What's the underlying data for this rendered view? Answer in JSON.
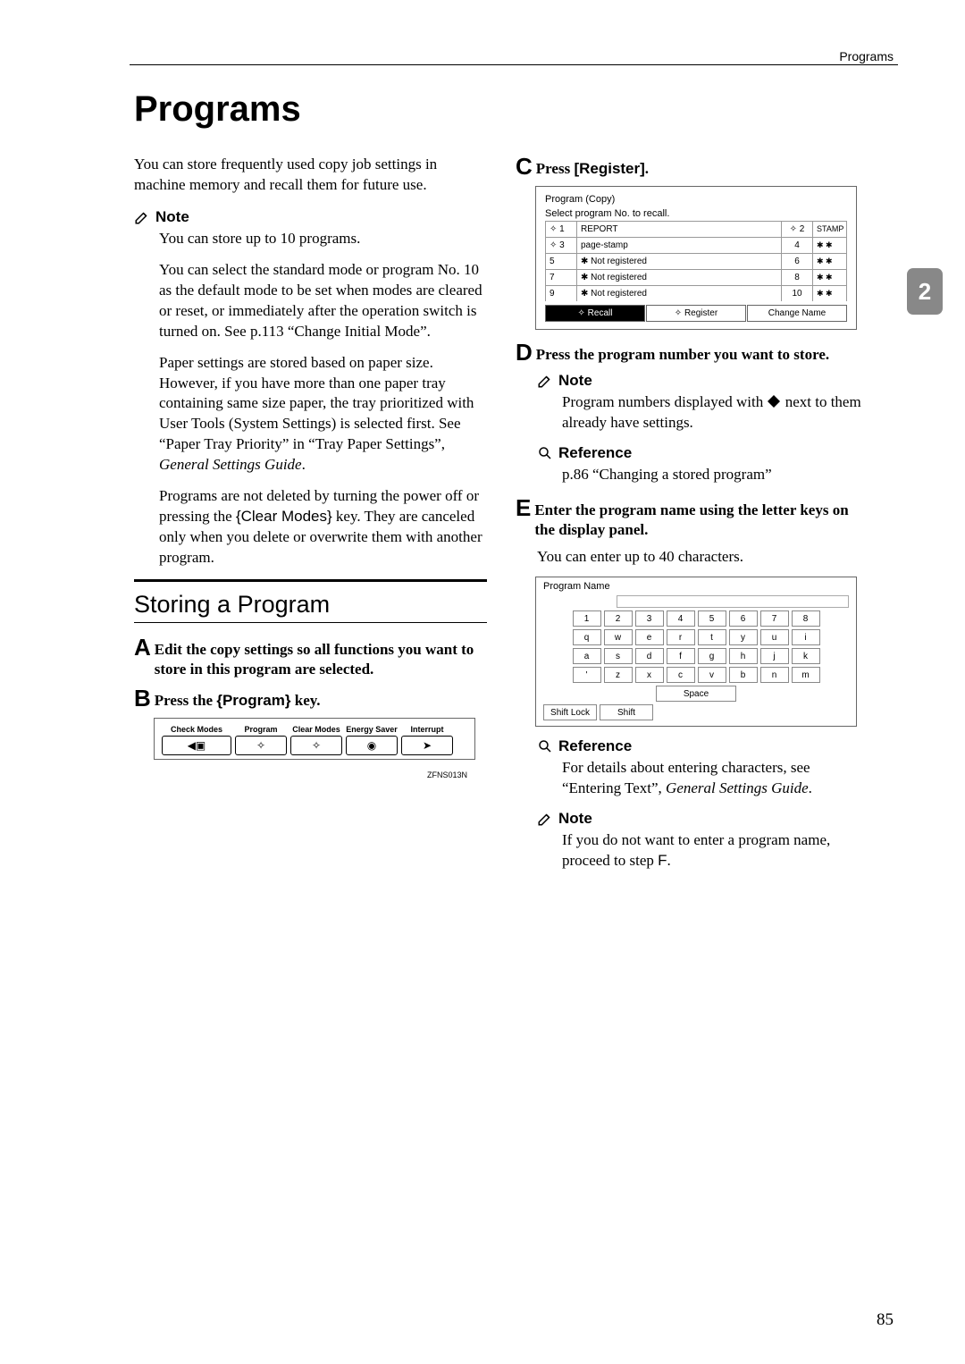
{
  "header": {
    "label": "Programs"
  },
  "title": "Programs",
  "page_tab": "2",
  "intro": "You can store frequently used copy job settings in machine memory and recall them for future use.",
  "note_label": "Note",
  "ref_label": "Reference",
  "left": {
    "note1": "You can store up to 10 programs.",
    "note2": "You can select the standard mode or program No. 10 as the default mode to be set when modes are cleared or reset, or immediately after the operation switch is turned on. See p.113 “Change Initial Mode”.",
    "note3_a": "Paper settings are stored based on paper size. However, if you have more than one paper tray containing same size paper, the tray prioritized with User Tools (System Settings) is selected first. See “Paper Tray Priority” in “Tray Paper Settings”, ",
    "note3_b": "General Settings Guide",
    "note3_c": ".",
    "note4_a": "Programs are not deleted by turning the power off or pressing the ",
    "note4_key": "{Clear Modes}",
    "note4_b": " key. They are canceled only when you delete or overwrite them with another program.",
    "h2": "Storing a Program",
    "stepA": "Edit the copy settings so all functions you want to store in this program are selected.",
    "stepB_a": "Press the ",
    "stepB_key": "{Program}",
    "stepB_b": " key.",
    "fig1": {
      "labels": [
        "Check Modes",
        "Program",
        "Clear Modes",
        "Energy Saver",
        "Interrupt"
      ],
      "code": "ZFNS013N"
    }
  },
  "right": {
    "stepC_a": "Press ",
    "stepC_key": "[Register]",
    "stepC_b": ".",
    "fig2": {
      "title": "Program (Copy)",
      "subtitle": "Select program No. to recall.",
      "rows": [
        {
          "a": "✧ 1",
          "b": "REPORT",
          "c": "✧ 2",
          "d": "STAMP"
        },
        {
          "a": "✧ 3",
          "b": "page-stamp",
          "c": "4",
          "d": "✱ ✱"
        },
        {
          "a": "5",
          "b": "✱ Not registered",
          "c": "6",
          "d": "✱ ✱"
        },
        {
          "a": "7",
          "b": "✱ Not registered",
          "c": "8",
          "d": "✱ ✱"
        },
        {
          "a": "9",
          "b": "✱ Not registered",
          "c": "10",
          "d": "✱ ✱"
        }
      ],
      "tabs": [
        "✧ Recall",
        "✧ Register",
        "Change Name"
      ]
    },
    "stepD": "Press the program number you want to store.",
    "noteD_a": "Program numbers displayed with ",
    "noteD_b": " next to them already have settings.",
    "refD": "p.86 “Changing a stored program”",
    "stepE": "Enter the program name using the letter keys on the display panel.",
    "stepE_sub": "You can enter up to 40 characters.",
    "fig3": {
      "title": "Program Name",
      "row1": [
        "1",
        "2",
        "3",
        "4",
        "5",
        "6",
        "7",
        "8"
      ],
      "row2": [
        "q",
        "w",
        "e",
        "r",
        "t",
        "y",
        "u",
        "i"
      ],
      "row3": [
        "a",
        "s",
        "d",
        "f",
        "g",
        "h",
        "j",
        "k"
      ],
      "row4": [
        "'",
        "z",
        "x",
        "c",
        "v",
        "b",
        "n",
        "m"
      ],
      "space": "Space",
      "shiftlock": "Shift Lock",
      "shift": "Shift"
    },
    "refE_a": "For details about entering characters, see “Entering Text”, ",
    "refE_b": "General Settings Guide",
    "refE_c": ".",
    "noteE_a": "If you do not want to enter a program name, proceed to step ",
    "noteE_b": "F",
    "noteE_c": "."
  },
  "page_number": "85"
}
